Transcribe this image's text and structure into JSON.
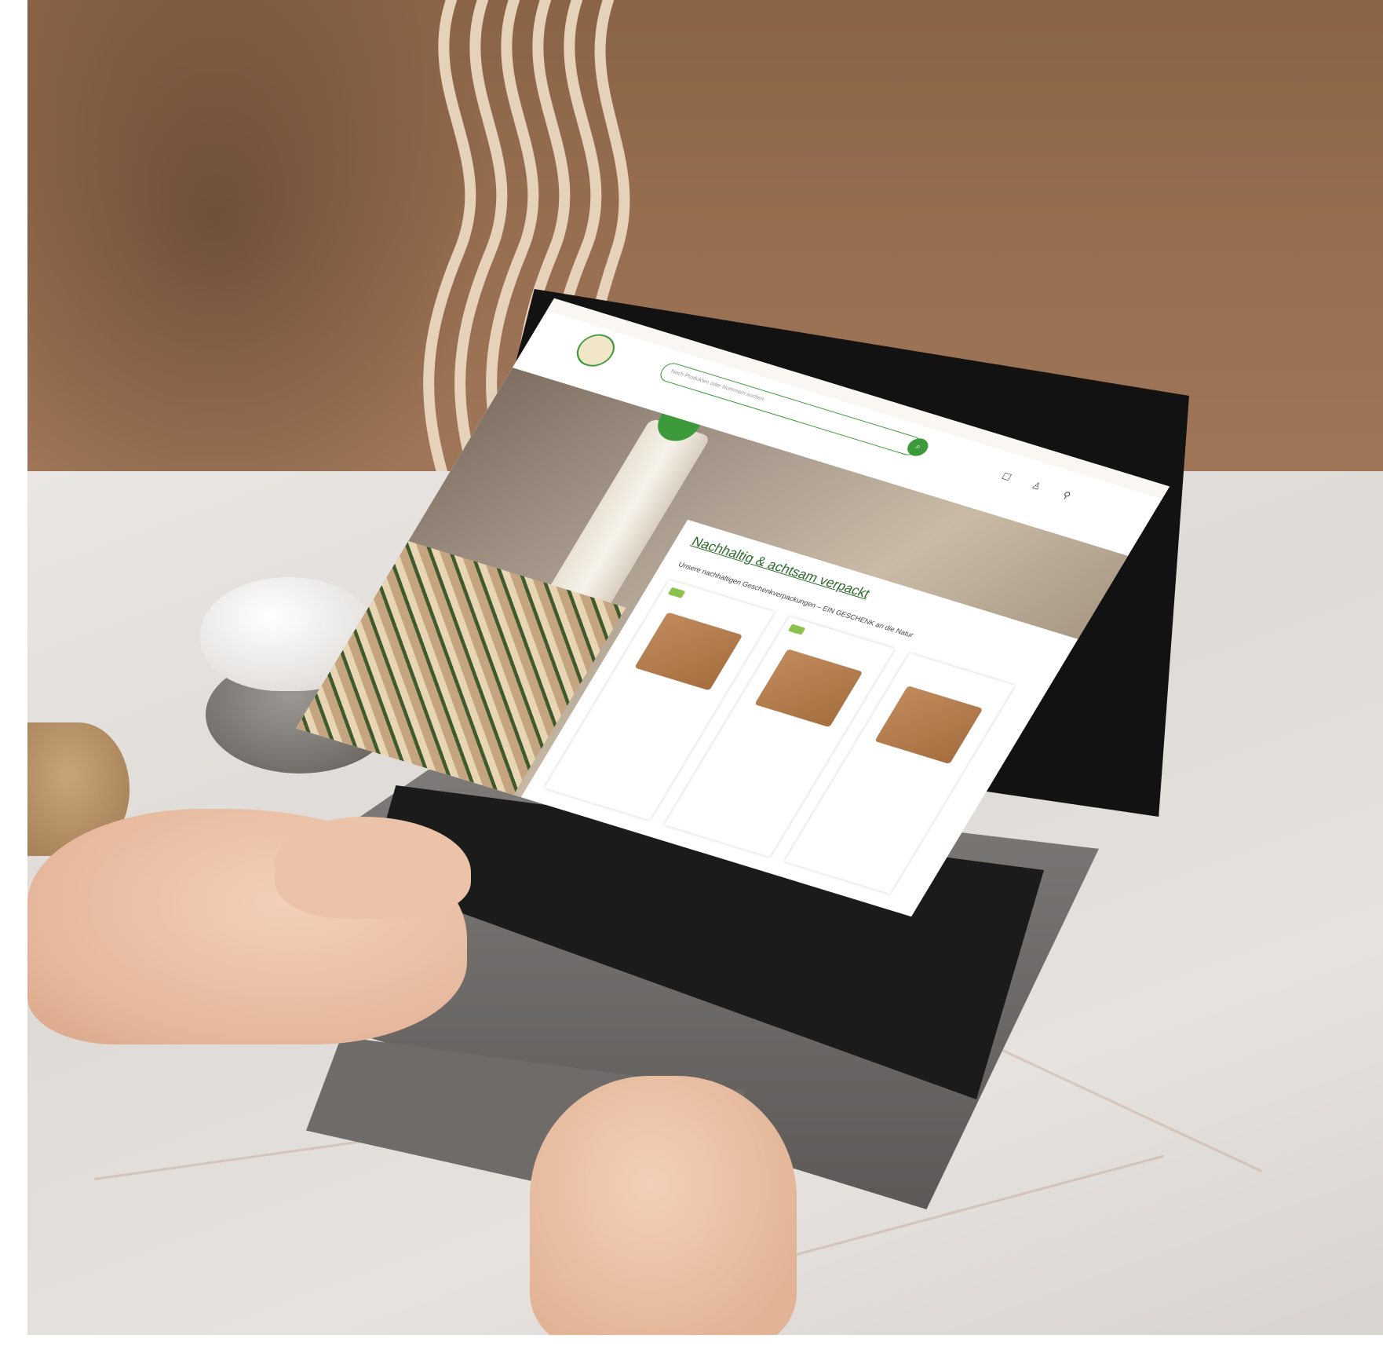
{
  "scene": {
    "description_free": true,
    "colors": {
      "wall": "#9a7052",
      "table": "#e3dfdb",
      "laptop": "#5c5957",
      "brand_green": "#3c9a3a"
    }
  },
  "website": {
    "search_placeholder": "Nach Produkten oder Nummern suchen",
    "hero_title": "Nachhaltig & achtsam verpackt",
    "hero_subtitle": "Unsere nachhaltigen Geschenkverpackungen – EIN GESCHENK an die Natur"
  }
}
